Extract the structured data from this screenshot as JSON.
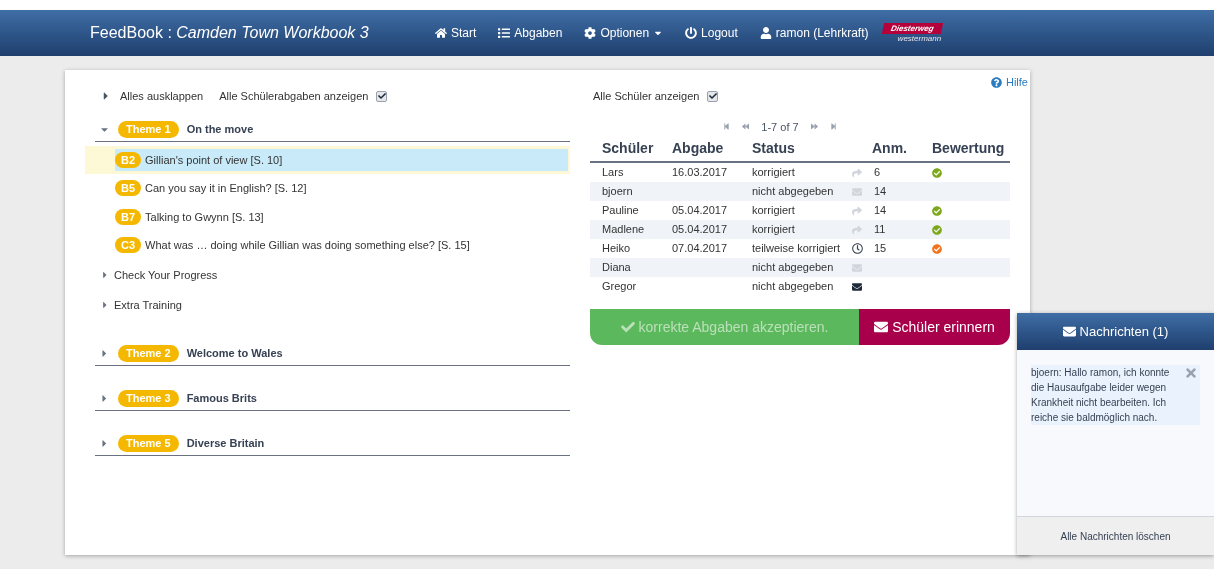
{
  "navbar": {
    "app": "FeedBook :",
    "book": "Camden Town Workbook 3",
    "links": [
      {
        "kind": "home",
        "label": "Start"
      },
      {
        "kind": "list",
        "label": "Abgaben"
      },
      {
        "kind": "gear",
        "label": "Optionen",
        "dropdown": true
      },
      {
        "kind": "power",
        "label": "Logout"
      },
      {
        "kind": "user",
        "label": "ramon (Lehrkraft)"
      }
    ],
    "logo": {
      "top": "Diesterweg",
      "bottom": "westermann"
    }
  },
  "toolbar": {
    "expand_all": "Alles ausklappen",
    "show_all_submissions": {
      "label": "Alle Schülerabgaben anzeigen",
      "checked": true
    }
  },
  "themes": [
    {
      "badge": "Theme 1",
      "title": "On the move",
      "expanded": true,
      "tasks": [
        {
          "badge": "B2",
          "label": "Gillian's point of view [S. 10]",
          "selected": true
        },
        {
          "badge": "B5",
          "label": "Can you say it in English? [S. 12]",
          "selected": false
        },
        {
          "badge": "B7",
          "label": "Talking to Gwynn [S. 13]",
          "selected": false
        },
        {
          "badge": "C3",
          "label": "What was … doing while Gillian was doing something else? [S. 15]",
          "selected": false
        }
      ],
      "groups": [
        {
          "label": "Check Your Progress",
          "expanded": false
        },
        {
          "label": "Extra Training",
          "expanded": false
        }
      ]
    },
    {
      "badge": "Theme 2",
      "title": "Welcome to Wales",
      "expanded": false
    },
    {
      "badge": "Theme 3",
      "title": "Famous Brits",
      "expanded": false
    },
    {
      "badge": "Theme 5",
      "title": "Diverse Britain",
      "expanded": false
    }
  ],
  "help": "Hilfe",
  "show_all_students": {
    "label": "Alle Schüler anzeigen",
    "checked": true
  },
  "pager": "1-7 of 7",
  "table": {
    "columns": [
      "Schüler",
      "Abgabe",
      "Status",
      "Anm.",
      "Bewertung"
    ],
    "rows": [
      {
        "name": "Lars",
        "date": "16.03.2017",
        "status": "korrigiert",
        "kind": "forward",
        "notes": "6",
        "color": "#7ea81c"
      },
      {
        "name": "bjoern",
        "status": "nicht abgegeben",
        "kind": "mail",
        "notes": "14"
      },
      {
        "name": "Pauline",
        "date": "05.04.2017",
        "status": "korrigiert",
        "kind": "forward",
        "notes": "14",
        "color": "#7ea81c"
      },
      {
        "name": "Madlene",
        "date": "05.04.2017",
        "status": "korrigiert",
        "kind": "forward",
        "notes": "11",
        "color": "#7ea81c"
      },
      {
        "name": "Heiko",
        "date": "07.04.2017",
        "status": "teilweise korrigiert",
        "kind": "clock",
        "notes": "15",
        "color": "#f0731e"
      },
      {
        "name": "Diana",
        "status": "nicht abgegeben",
        "kind": "mail"
      },
      {
        "name": "Gregor",
        "status": "nicht abgegeben",
        "kind": "reminded"
      }
    ]
  },
  "actions": {
    "accept": {
      "label": "korrekte Abgaben akzeptieren.",
      "disabled": true
    },
    "remind": "Schüler erinnern"
  },
  "messages": {
    "title": "Nachrichten (1)",
    "items": [
      "bjoern: Hallo ramon, ich konnte die Hausaufgabe leider wegen Krankheit nicht bearbeiten. Ich reiche sie baldmöglich nach."
    ],
    "clear": "Alle Nachrichten löschen"
  }
}
